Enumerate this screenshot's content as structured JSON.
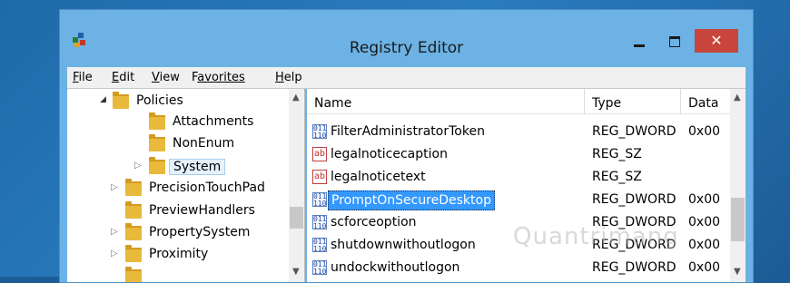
{
  "window": {
    "title": "Registry Editor",
    "close_glyph": "✕"
  },
  "menu": [
    {
      "accel": "F",
      "rest": "ile"
    },
    {
      "accel": "E",
      "rest": "dit"
    },
    {
      "accel": "V",
      "rest": "iew"
    },
    {
      "accel": "F",
      "rest": "avorites",
      "pre": ""
    },
    {
      "accel": "H",
      "rest": "elp"
    }
  ],
  "tree": [
    {
      "label": "Policies",
      "expander": "◢",
      "selected": false
    },
    {
      "label": "Attachments",
      "selected": false
    },
    {
      "label": "NonEnum",
      "selected": false
    },
    {
      "label": "System",
      "expander": "▷",
      "selected": true
    },
    {
      "label": "PrecisionTouchPad",
      "expander": "▷",
      "selected": false
    },
    {
      "label": "PreviewHandlers",
      "selected": false
    },
    {
      "label": "PropertySystem",
      "expander": "▷",
      "selected": false
    },
    {
      "label": "Proximity",
      "expander": "▷",
      "selected": false
    }
  ],
  "columns": {
    "name": "Name",
    "type": "Type",
    "data": "Data"
  },
  "values": [
    {
      "icon": "dword-icon",
      "glyph": "011 110",
      "name": "FilterAdministratorToken",
      "type": "REG_DWORD",
      "data": "0x00"
    },
    {
      "icon": "string-icon",
      "glyph": "ab",
      "name": "legalnoticecaption",
      "type": "REG_SZ",
      "data": ""
    },
    {
      "icon": "string-icon",
      "glyph": "ab",
      "name": "legalnoticetext",
      "type": "REG_SZ",
      "data": ""
    },
    {
      "icon": "dword-icon",
      "glyph": "011 110",
      "name": "PromptOnSecureDesktop",
      "type": "REG_DWORD",
      "data": "0x00",
      "selected": true
    },
    {
      "icon": "dword-icon",
      "glyph": "011 110",
      "name": "scforceoption",
      "type": "REG_DWORD",
      "data": "0x00"
    },
    {
      "icon": "dword-icon",
      "glyph": "011 110",
      "name": "shutdownwithoutlogon",
      "type": "REG_DWORD",
      "data": "0x00"
    },
    {
      "icon": "dword-icon",
      "glyph": "011 110",
      "name": "undockwithoutlogon",
      "type": "REG_DWORD",
      "data": "0x00"
    }
  ],
  "watermark": "Quantrimang"
}
